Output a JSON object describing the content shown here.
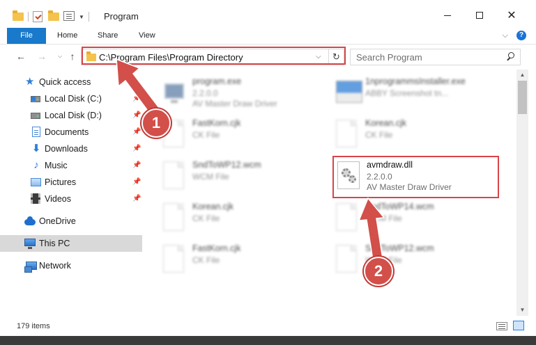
{
  "window": {
    "title": "Program",
    "minimize_glyph": "",
    "close_glyph": "✕"
  },
  "ribbon": {
    "tabs": [
      "File",
      "Home",
      "Share",
      "View"
    ],
    "help_glyph": "?"
  },
  "nav": {
    "address": "C:\\Program Files\\Program Directory",
    "search_placeholder": "Search Program"
  },
  "sidebar": {
    "items": [
      {
        "label": "Quick access",
        "icon": "star-icon"
      },
      {
        "label": "Local Disk (C:)",
        "icon": "disk-icon"
      },
      {
        "label": "Local Disk (D:)",
        "icon": "disk-icon"
      },
      {
        "label": "Documents",
        "icon": "documents-icon"
      },
      {
        "label": "Downloads",
        "icon": "downloads-icon"
      },
      {
        "label": "Music",
        "icon": "music-icon"
      },
      {
        "label": "Pictures",
        "icon": "pictures-icon"
      },
      {
        "label": "Videos",
        "icon": "videos-icon"
      },
      {
        "label": "OneDrive",
        "icon": "onedrive-icon"
      },
      {
        "label": "This PC",
        "icon": "this-pc-icon"
      },
      {
        "label": "Network",
        "icon": "network-icon"
      }
    ]
  },
  "files": [
    {
      "name": "program.exe",
      "line1": "2.2.0.0",
      "line2": "AV Master Draw Driver",
      "icon": "exe-icon",
      "blurred": true
    },
    {
      "name": "1nprogrammsInstaller.exe",
      "line1": "ABBY Screenshot tn...",
      "line2": "",
      "icon": "installer-icon",
      "blurred": true
    },
    {
      "name": "FastKorn.cjk",
      "line1": "CK File",
      "line2": "",
      "icon": "file-icon",
      "blurred": true
    },
    {
      "name": "Korean.cjk",
      "line1": "CK File",
      "line2": "",
      "icon": "file-icon",
      "blurred": true
    },
    {
      "name": "SndToWP12.wcm",
      "line1": "WCM File",
      "line2": "",
      "icon": "file-icon",
      "blurred": true
    },
    {
      "name": "avmdraw.dll",
      "line1": "2.2.0.0",
      "line2": "AV Master Draw Driver",
      "icon": "dll-gear-icon",
      "blurred": false
    },
    {
      "name": "Korean.cjk",
      "line1": "CK File",
      "line2": "",
      "icon": "file-icon",
      "blurred": true
    },
    {
      "name": "SndToWP14.wcm",
      "line1": "WCM File",
      "line2": "",
      "icon": "file-icon",
      "blurred": true
    },
    {
      "name": "FastKorn.cjk",
      "line1": "CK File",
      "line2": "",
      "icon": "file-icon",
      "blurred": true
    },
    {
      "name": "SndToWP12.wcm",
      "line1": "WCM File",
      "line2": "",
      "icon": "file-icon",
      "blurred": true
    }
  ],
  "status": {
    "item_count": "179 items"
  },
  "callouts": {
    "one": "1",
    "two": "2"
  },
  "colors": {
    "accent": "#1979ca",
    "highlight_red": "#d84448",
    "callout_red": "#d24f4a"
  }
}
